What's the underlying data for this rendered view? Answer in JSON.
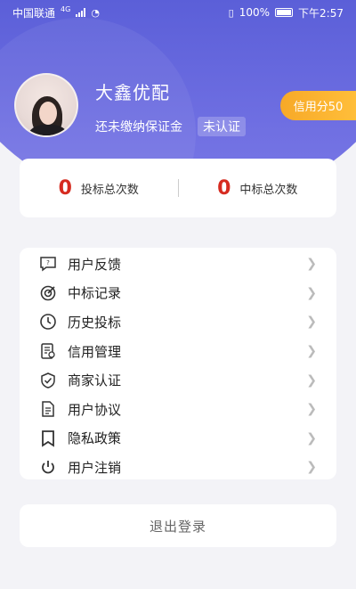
{
  "status_bar": {
    "carrier": "中国联通",
    "network": "4G",
    "battery": "100%",
    "time": "下午2:57"
  },
  "profile": {
    "name": "大鑫优配",
    "deposit_text": "还未缴纳保证金",
    "cert_status": "未认证",
    "credit_label": "信用分50"
  },
  "stats": [
    {
      "value": "0",
      "label": "投标总次数"
    },
    {
      "value": "0",
      "label": "中标总次数"
    }
  ],
  "menu": [
    {
      "label": "用户反馈",
      "icon": "feedback-icon"
    },
    {
      "label": "中标记录",
      "icon": "target-icon"
    },
    {
      "label": "历史投标",
      "icon": "clock-icon"
    },
    {
      "label": "信用管理",
      "icon": "credit-doc-icon"
    },
    {
      "label": "商家认证",
      "icon": "shield-check-icon"
    },
    {
      "label": "用户协议",
      "icon": "document-icon"
    },
    {
      "label": "隐私政策",
      "icon": "bookmark-icon"
    },
    {
      "label": "用户注销",
      "icon": "power-icon"
    }
  ],
  "logout_label": "退出登录",
  "colors": {
    "header_gradient": "#5b5fd8",
    "accent_red": "#d62b20",
    "credit_orange": "#f7a928"
  }
}
